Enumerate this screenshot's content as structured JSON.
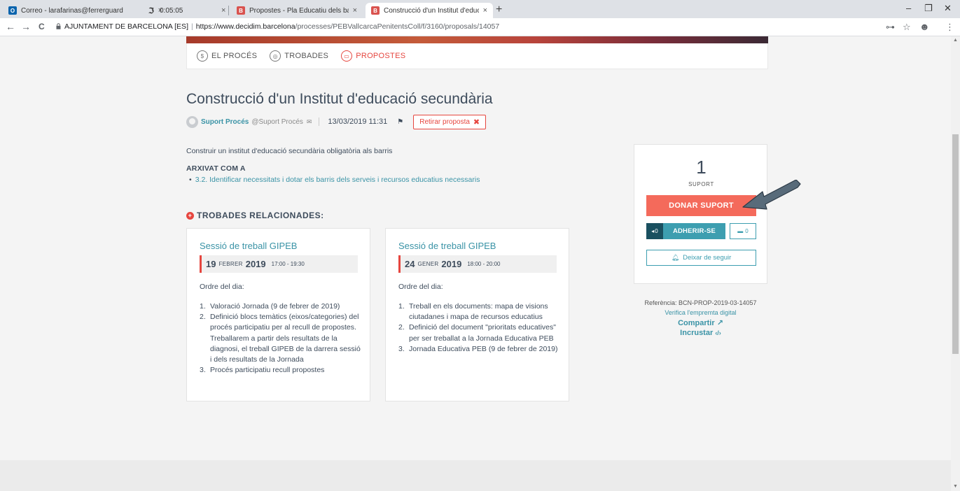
{
  "browser": {
    "tabs": [
      {
        "label": "Correo - larafarinas@ferrerguard",
        "close": "×"
      },
      {
        "label": "0:05:05",
        "close": "×"
      },
      {
        "label": "Propostes - Pla Educatiu dels bar",
        "close": "×"
      },
      {
        "label": "Construcció d'un Institut d'educa",
        "close": "×"
      }
    ],
    "new_tab": "+",
    "window": {
      "minimize": "–",
      "restore": "❐",
      "close": "✕"
    },
    "nav": {
      "back": "←",
      "forward": "→",
      "reload": "C"
    },
    "address": {
      "site": "AJUNTAMENT DE BARCELONA [ES]",
      "separator": "|",
      "host": "https://www.decidim.barcelona",
      "path": "/processes/PEBVallcarcaPenitentsColl/f/3160/proposals/14057"
    },
    "toolbar": {
      "key": "⊶",
      "star": "☆",
      "profile": "☻",
      "menu": "⋮"
    }
  },
  "process_nav": [
    {
      "label": "EL PROCÉS",
      "icon": "$"
    },
    {
      "label": "TROBADES",
      "icon": "◎"
    },
    {
      "label": "PROPOSTES",
      "icon": "▭"
    }
  ],
  "proposal": {
    "title": "Construcció d'un Institut d'educació secundària",
    "author_name": "Suport Procés",
    "author_handle": "@Suport Procés",
    "date": "13/03/2019 11:31",
    "withdraw_label": "Retirar proposta",
    "withdraw_x": "✖",
    "body": "Construir un institut d'educació secundària obligatòria als barris",
    "archived_label": "ARXIVAT COM A",
    "archived_item": "3.2. Identificar necessitats i dotar els barris dels serveis i recursos educatius necessaris"
  },
  "related": {
    "heading": "TROBADES RELACIONADES:",
    "meetings": [
      {
        "title": "Sessió de treball GIPEB",
        "day": "19",
        "month": "FEBRER",
        "year": "2019",
        "time": "17:00 - 19:30",
        "agenda_label": "Ordre del dia:",
        "items": [
          {
            "num": "1.",
            "text": "Valoració Jornada (9 de febrer de 2019)"
          },
          {
            "num": "2.",
            "text": "Definició blocs temàtics (eixos/categories) del procés participatiu per al recull de propostes. Treballarem a partir dels resultats de la diagnosi, el treball GIPEB de la darrera sessió i dels resultats de la Jornada"
          },
          {
            "num": "3.",
            "text": "Procés participatiu recull propostes"
          }
        ]
      },
      {
        "title": "Sessió de treball GIPEB",
        "day": "24",
        "month": "GENER",
        "year": "2019",
        "time": "18:00 - 20:00",
        "agenda_label": "Ordre del dia:",
        "items": [
          {
            "num": "1.",
            "text": "Treball en els documents: mapa de visions ciutadanes i mapa de recursos educatius"
          },
          {
            "num": "2.",
            "text": "Definició del document \"prioritats educatives\" per ser treballat a la Jornada Educativa PEB"
          },
          {
            "num": "3.",
            "text": "Jornada Educativa PEB (9 de febrer de 2019)"
          }
        ]
      }
    ]
  },
  "support": {
    "count": "1",
    "count_label": "SUPORT",
    "button": "DONAR SUPORT",
    "adhere_count": "0",
    "adhere_label": "ADHERIR-SE",
    "comments_count": "0",
    "follow_label": "Deixar de seguir"
  },
  "references": {
    "ref": "Referència: BCN-PROP-2019-03-14057",
    "verify": "Verifica l'empremta digital",
    "share": "Compartir",
    "embed": "Incrustar"
  },
  "colors": {
    "accent": "#e6463f",
    "support_button": "#f46a5b",
    "link": "#3a93a6",
    "adhere": "#3d9eb0"
  }
}
